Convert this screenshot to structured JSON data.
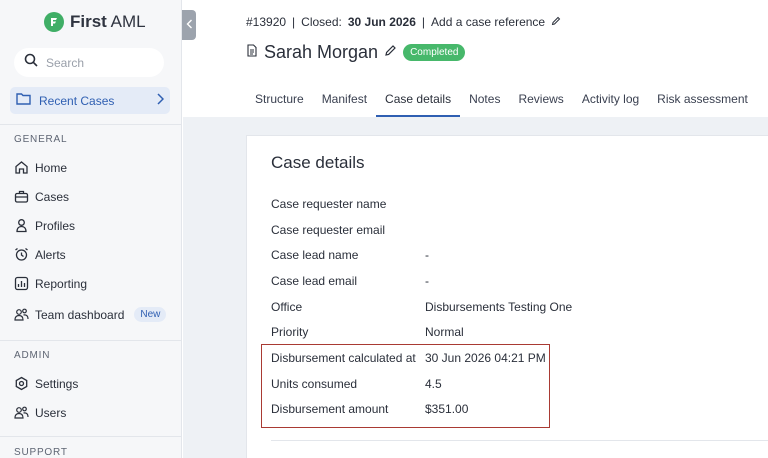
{
  "brand": {
    "name": "First AML",
    "first": "First",
    "second": "AML"
  },
  "sidebar": {
    "search_placeholder": "Search",
    "recent_cases": "Recent Cases",
    "sections": {
      "general": "GENERAL",
      "admin": "ADMIN",
      "support": "SUPPORT"
    },
    "general_items": [
      {
        "label": "Home",
        "icon": "home-icon"
      },
      {
        "label": "Cases",
        "icon": "briefcase-icon"
      },
      {
        "label": "Profiles",
        "icon": "person-icon"
      },
      {
        "label": "Alerts",
        "icon": "alarm-icon"
      },
      {
        "label": "Reporting",
        "icon": "chart-icon"
      },
      {
        "label": "Team dashboard",
        "icon": "team-icon",
        "badge": "New"
      }
    ],
    "admin_items": [
      {
        "label": "Settings",
        "icon": "gear-icon"
      },
      {
        "label": "Users",
        "icon": "users-icon"
      }
    ]
  },
  "header": {
    "case_number": "#13920",
    "closed_label": "Closed:",
    "closed_date": "30 Jun 2026",
    "add_reference": "Add a case reference",
    "name": "Sarah Morgan",
    "status": "Completed"
  },
  "tabs": [
    "Structure",
    "Manifest",
    "Case details",
    "Notes",
    "Reviews",
    "Activity log",
    "Risk assessment"
  ],
  "active_tab": "Case details",
  "case_details": {
    "title": "Case details",
    "rows": [
      {
        "label": "Case requester name",
        "value": ""
      },
      {
        "label": "Case requester email",
        "value": ""
      },
      {
        "label": "Case lead name",
        "value": "-"
      },
      {
        "label": "Case lead email",
        "value": "-"
      },
      {
        "label": "Office",
        "value": "Disbursements Testing One"
      },
      {
        "label": "Priority",
        "value": "Normal"
      },
      {
        "label": "Disbursement calculated at",
        "value": "30 Jun 2026 04:21 PM"
      },
      {
        "label": "Units consumed",
        "value": "4.5"
      },
      {
        "label": "Disbursement amount",
        "value": "$351.00"
      }
    ]
  },
  "colors": {
    "accent": "#2f5fb2",
    "status": "#47b86b",
    "highlight": "#a93a33"
  }
}
